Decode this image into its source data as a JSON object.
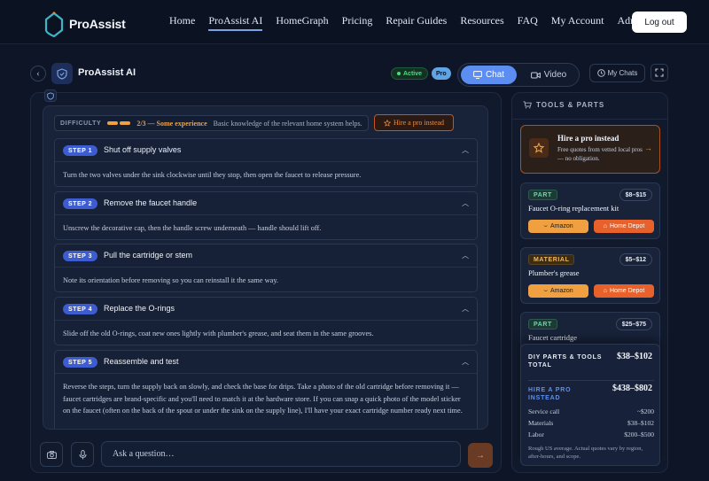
{
  "nav": {
    "brand": "ProAssist",
    "links": [
      "Home",
      "ProAssist AI",
      "HomeGraph",
      "Pricing",
      "Repair Guides",
      "Resources",
      "FAQ",
      "My Account",
      "Admin"
    ],
    "logout_label": "Log out"
  },
  "header": {
    "title": "ProAssist AI",
    "status_badge": "Active",
    "tier_badge": "Pro",
    "mode_chat": "Chat",
    "mode_video": "Video",
    "my_chats": "My Chats"
  },
  "difficulty": {
    "label": "DIFFICULTY",
    "level": 2,
    "max": 3,
    "score": "2/3 — Some experience",
    "description": "Basic knowledge of the relevant home system helps.",
    "hire_button": "Hire a pro instead"
  },
  "steps": [
    {
      "pill": "STEP 1",
      "title": "Shut off supply valves",
      "body": "Turn the two valves under the sink clockwise until they stop, then open the faucet to release pressure."
    },
    {
      "pill": "STEP 2",
      "title": "Remove the faucet handle",
      "body": "Unscrew the decorative cap, then the handle screw underneath — handle should lift off."
    },
    {
      "pill": "STEP 3",
      "title": "Pull the cartridge or stem",
      "body": "Note its orientation before removing so you can reinstall it the same way."
    },
    {
      "pill": "STEP 4",
      "title": "Replace the O-rings",
      "body": "Slide off the old O-rings, coat new ones lightly with plumber's grease, and seat them in the same grooves."
    },
    {
      "pill": "STEP 5",
      "title": "Reassemble and test",
      "body": "Reverse the steps, turn the supply back on slowly, and check the base for drips. Take a photo of the old cartridge before removing it — faucet cartridges are brand-specific and you'll need to match it at the hardware store. If you can snap a quick photo of the model sticker on the faucet (often on the back of the spout or under the sink on the supply line), I'll have your exact cartridge number ready next time."
    }
  ],
  "composer": {
    "placeholder": "Ask a question…"
  },
  "tools": {
    "header": "TOOLS & PARTS",
    "hire_card": {
      "title": "Hire a pro instead",
      "subtitle": "Free quotes from vetted local pros — no obligation."
    },
    "items": [
      {
        "tag": "PART",
        "price": "$8–$15",
        "name": "Faucet O-ring replacement kit",
        "amazon": "Amazon",
        "homedepot": "Home Depot"
      },
      {
        "tag": "MATERIAL",
        "price": "$5–$12",
        "name": "Plumber's grease",
        "amazon": "Amazon",
        "homedepot": "Home Depot"
      },
      {
        "tag": "PART",
        "price": "$25–$75",
        "name": "Faucet cartridge"
      }
    ],
    "totals": {
      "diy_label": "DIY PARTS & TOOLS TOTAL",
      "diy_value": "$38–$102",
      "pro_label": "HIRE A PRO INSTEAD",
      "pro_value": "$438–$802",
      "rows": [
        {
          "label": "Service call",
          "value": "~$200"
        },
        {
          "label": "Materials",
          "value": "$38–$102"
        },
        {
          "label": "Labor",
          "value": "$200–$500"
        }
      ],
      "note": "Rough US average. Actual quotes vary by region, after-hours, and scope."
    }
  },
  "colors": {
    "accent": "#5b8ef0",
    "orange": "#f08a3c",
    "amazon": "#f0a040",
    "home_depot": "#e8602a",
    "active_green": "#4ade80"
  }
}
